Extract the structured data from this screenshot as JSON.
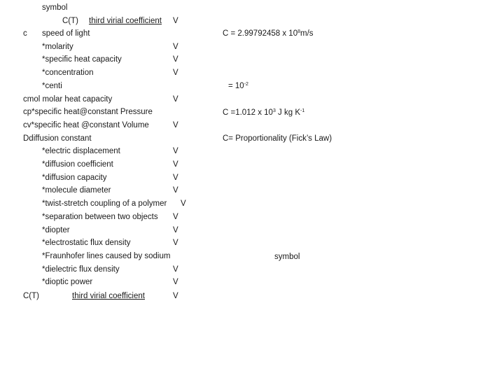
{
  "header": {
    "symbol_label": "symbol",
    "first_row": {
      "symbol": "C(T)",
      "name": "third virial coefficient",
      "mark": "V"
    }
  },
  "rows": [
    {
      "prefix": "c",
      "label": "speed of light",
      "mark": ""
    },
    {
      "prefix": "",
      "label": "*molarity",
      "mark": "V"
    },
    {
      "prefix": "",
      "label": "*specific heat capacity",
      "mark": "V"
    },
    {
      "prefix": "",
      "label": "*concentration",
      "mark": "V"
    },
    {
      "prefix": "",
      "label": "*centi",
      "mark": ""
    },
    {
      "prefix": "",
      "label": "cmol molar heat capacity",
      "mark": "V"
    },
    {
      "prefix": "",
      "label": "cp*specific heat@constant Pressure",
      "mark": ""
    },
    {
      "prefix": "",
      "label": "cv*specific heat @constant Volume",
      "mark": "V"
    },
    {
      "prefix": "",
      "label": "Ddiffusion constant",
      "mark": ""
    },
    {
      "prefix": "",
      "label": "*electric displacement",
      "mark": "V"
    },
    {
      "prefix": "",
      "label": "*diffusion coefficient",
      "mark": "V"
    },
    {
      "prefix": "",
      "label": "*diffusion capacity",
      "mark": "V"
    },
    {
      "prefix": "",
      "label": "*molecule diameter",
      "mark": "V"
    },
    {
      "prefix": "",
      "label": "*twist-stretch coupling of a polymer",
      "mark": "V"
    },
    {
      "prefix": "",
      "label": "*separation between two objects",
      "mark": "V"
    },
    {
      "prefix": "",
      "label": "*diopter",
      "mark": "V"
    },
    {
      "prefix": "",
      "label": "*electrostatic flux density",
      "mark": "V"
    },
    {
      "prefix": "",
      "label": "*Fraunhofer lines caused by sodium",
      "mark": ""
    },
    {
      "prefix": "",
      "label": "*dielectric flux density",
      "mark": "V"
    },
    {
      "prefix": "",
      "label": "*dioptic power",
      "mark": "V"
    }
  ],
  "footer_row": {
    "symbol": "C(T)",
    "name": "third virial coefficient",
    "mark": "V"
  },
  "notes": {
    "speed_of_light": {
      "base": "C = 2.99792458 x 10",
      "exp": "8",
      "unit": "m/s"
    },
    "centi": {
      "base": "= 10",
      "exp": "-2"
    },
    "specific_heat": {
      "base": "C =1.012 x 10",
      "exp": "3",
      "mid": " J kg K",
      "exp2": "-1"
    },
    "diffusion": "C=  Proportionality (Fick’s Law)",
    "symbol_label": "symbol"
  }
}
